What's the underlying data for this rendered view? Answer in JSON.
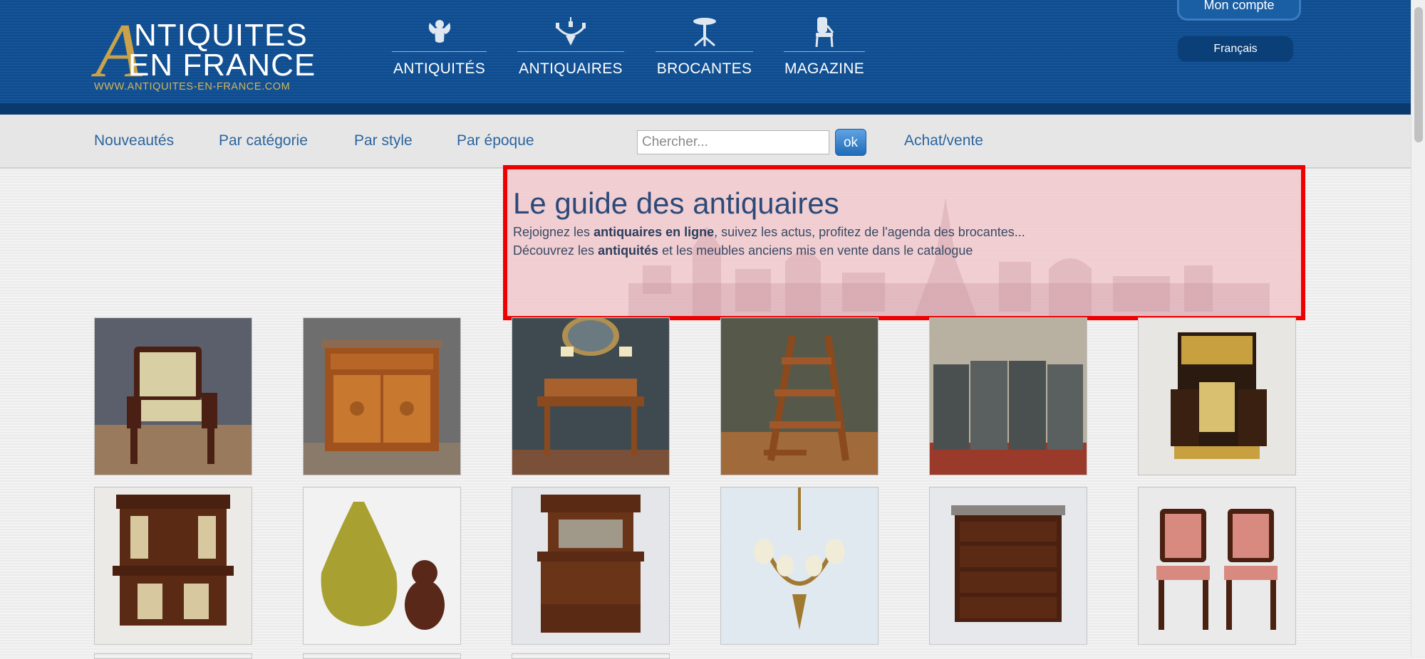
{
  "header": {
    "logo": {
      "initial": "A",
      "line1": "NTIQUITES",
      "line2": "EN FRANCE",
      "url": "WWW.ANTIQUITES-EN-FRANCE.COM"
    },
    "nav": [
      {
        "label": "ANTIQUITÉS",
        "icon": "cherub-icon"
      },
      {
        "label": "ANTIQUAIRES",
        "icon": "chandelier-icon"
      },
      {
        "label": "BROCANTES",
        "icon": "pedestal-table-icon"
      },
      {
        "label": "MAGAZINE",
        "icon": "chair-icon"
      }
    ],
    "account_label": "Mon compte",
    "language_label": "Français"
  },
  "subnav": {
    "links": [
      "Nouveautés",
      "Par catégorie",
      "Par style",
      "Par époque"
    ],
    "search_placeholder": "Chercher...",
    "search_button": "ok",
    "buy_sell": "Achat/vente"
  },
  "hero": {
    "title": "Le guide des antiquaires",
    "line1": {
      "before": "Rejoignez les ",
      "bold": "antiquaires en ligne",
      "after": ", suivez les actus, profitez de l'agenda des brocantes..."
    },
    "line2": {
      "before": "Découvrez les ",
      "bold": "antiquités",
      "after": " et les meubles anciens mis en vente dans le catalogue"
    }
  },
  "products": [
    {
      "subject": "empire-armchair"
    },
    {
      "subject": "marquetry-cabinet"
    },
    {
      "subject": "writing-desk-with-lamps"
    },
    {
      "subject": "library-ladder"
    },
    {
      "subject": "folding-screen"
    },
    {
      "subject": "boulle-liquor-cabinet"
    },
    {
      "subject": "renaissance-buffet"
    },
    {
      "subject": "pear-and-bulldog"
    },
    {
      "subject": "carved-sideboard"
    },
    {
      "subject": "bronze-chandelier"
    },
    {
      "subject": "carved-chest-of-drawers"
    },
    {
      "subject": "pair-of-armchairs"
    }
  ],
  "colors": {
    "header_blue": "#0e4f94",
    "logo_gold": "#c9a24a",
    "link_blue": "#2b65a0",
    "highlight_red": "#ee0000"
  }
}
